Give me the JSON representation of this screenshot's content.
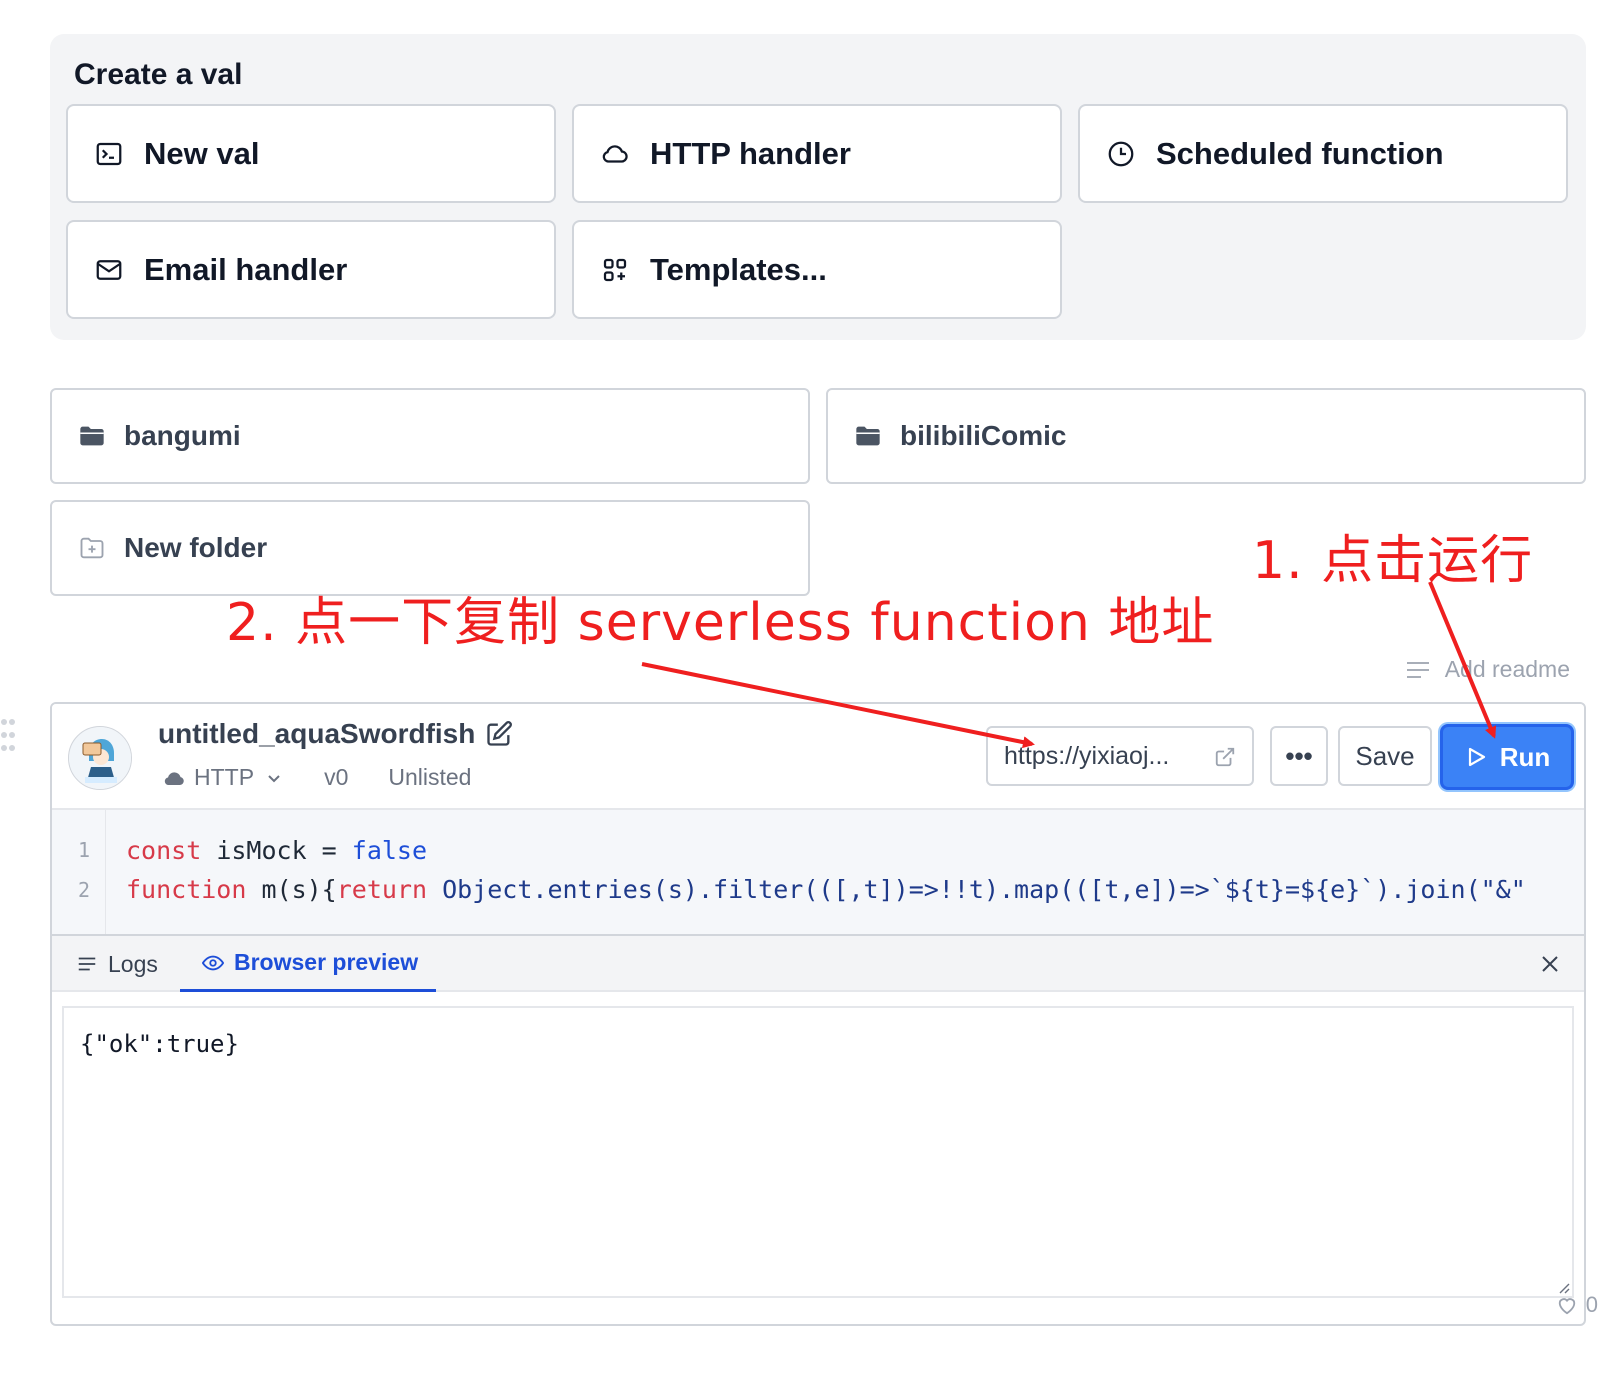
{
  "create": {
    "title": "Create a val",
    "buttons": [
      {
        "label": "New val",
        "icon": "terminal-icon"
      },
      {
        "label": "HTTP handler",
        "icon": "cloud-icon"
      },
      {
        "label": "Scheduled function",
        "icon": "clock-icon"
      },
      {
        "label": "Email handler",
        "icon": "mail-icon"
      },
      {
        "label": "Templates...",
        "icon": "templates-icon"
      }
    ]
  },
  "folders": [
    {
      "label": "bangumi",
      "icon": "folder-icon"
    },
    {
      "label": "bilibiliComic",
      "icon": "folder-icon"
    },
    {
      "label": "New folder",
      "icon": "folder-plus-icon"
    }
  ],
  "annotations": {
    "step1": "1. 点击运行",
    "step2": "2. 点一下复制 serverless function 地址",
    "color": "#ef1f1f"
  },
  "add_readme": "Add readme",
  "val": {
    "name": "untitled_aquaSwordfish",
    "type": "HTTP",
    "version": "v0",
    "privacy": "Unlisted",
    "url": "https://yixiaoj...",
    "more": "•••",
    "save": "Save",
    "run": "Run",
    "code": {
      "line_numbers": [
        "1",
        "2"
      ],
      "line1": {
        "kw": "const",
        "rest": " isMock = ",
        "lit": "false"
      },
      "line2": {
        "kw1": "function",
        "a": " m(s){",
        "kw2": "return",
        "b": " Object.entries(s).filter(([,t])=>!!t).map(([t,e])=>`${t}=${e}`).join(\"&\""
      }
    },
    "tabs": {
      "logs": "Logs",
      "preview": "Browser preview"
    },
    "preview_output": "{\"ok\":true}"
  },
  "likes": "0",
  "colors": {
    "accent": "#3b82f6",
    "tab_active": "#1d4ed8",
    "panel_bg": "#f3f4f6"
  }
}
